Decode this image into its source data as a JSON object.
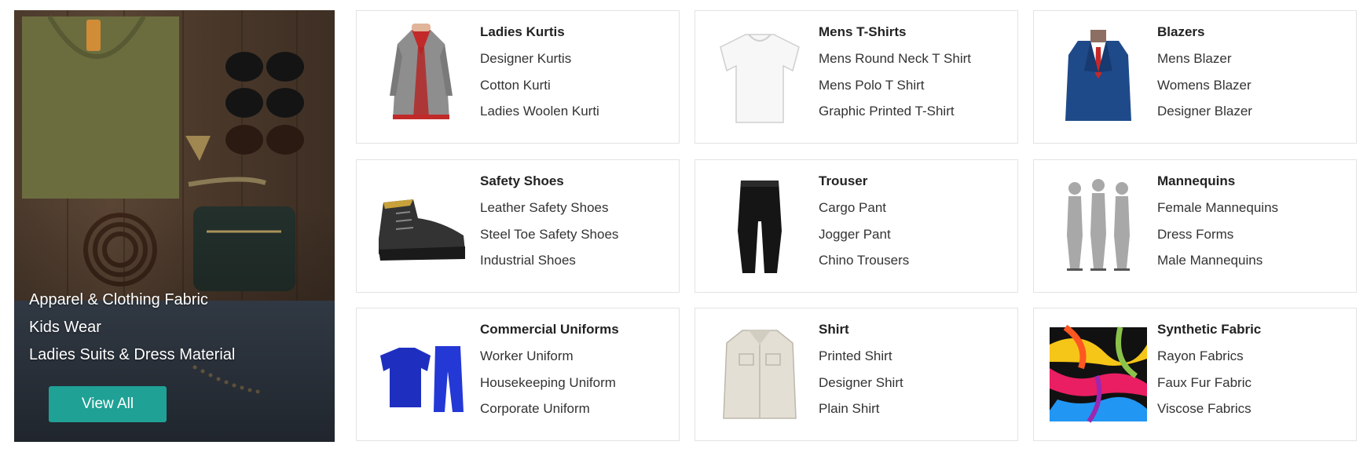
{
  "hero": {
    "links": [
      "Apparel & Clothing Fabric",
      "Kids Wear",
      "Ladies Suits & Dress Material"
    ],
    "button_label": "View All",
    "accent_color": "#1fa195"
  },
  "cards": [
    {
      "title": "Ladies Kurtis",
      "items": [
        "Designer Kurtis",
        "Cotton Kurti",
        "Ladies Woolen Kurti"
      ],
      "icon": "kurti-image"
    },
    {
      "title": "Mens T-Shirts",
      "items": [
        "Mens Round Neck T Shirt",
        "Mens Polo T Shirt",
        "Graphic Printed T-Shirt"
      ],
      "icon": "tshirt-image"
    },
    {
      "title": "Blazers",
      "items": [
        "Mens Blazer",
        "Womens Blazer",
        "Designer Blazer"
      ],
      "icon": "blazer-image"
    },
    {
      "title": "Safety Shoes",
      "items": [
        "Leather Safety Shoes",
        "Steel Toe Safety Shoes",
        "Industrial Shoes"
      ],
      "icon": "safety-shoe-image"
    },
    {
      "title": "Trouser",
      "items": [
        "Cargo Pant",
        "Jogger Pant",
        "Chino Trousers"
      ],
      "icon": "trouser-image"
    },
    {
      "title": "Mannequins",
      "items": [
        "Female Mannequins",
        "Dress Forms",
        "Male Mannequins"
      ],
      "icon": "mannequins-image"
    },
    {
      "title": "Commercial Uniforms",
      "items": [
        "Worker Uniform",
        "Housekeeping Uniform",
        "Corporate Uniform"
      ],
      "icon": "uniform-image"
    },
    {
      "title": "Shirt",
      "items": [
        "Printed Shirt",
        "Designer Shirt",
        "Plain Shirt"
      ],
      "icon": "shirt-image"
    },
    {
      "title": "Synthetic Fabric",
      "items": [
        "Rayon Fabrics",
        "Faux Fur Fabric",
        "Viscose Fabrics"
      ],
      "icon": "fabric-image"
    }
  ]
}
